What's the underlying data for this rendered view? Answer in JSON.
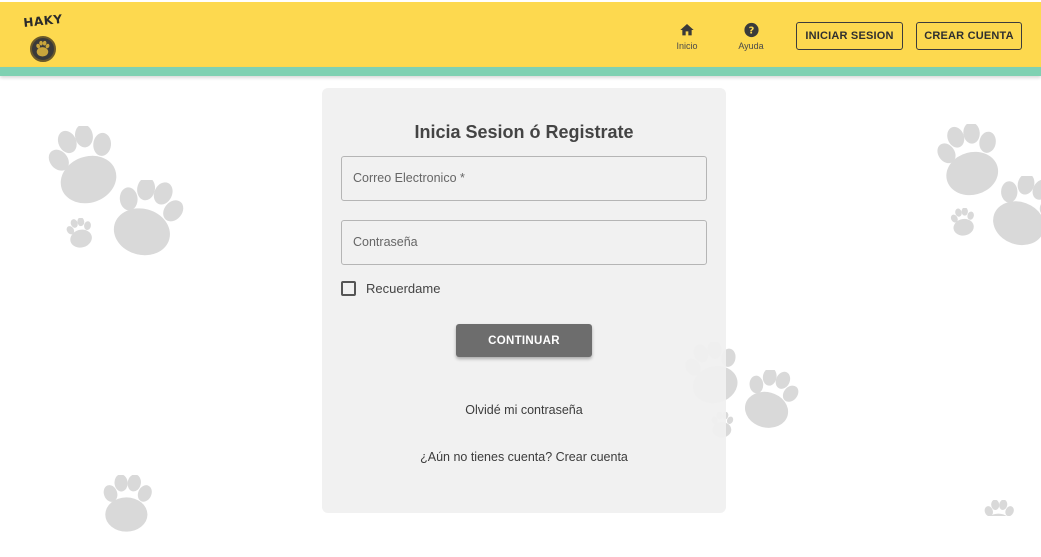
{
  "header": {
    "logo_text": "HAKY",
    "nav": [
      {
        "label": "Inicio",
        "icon": "home-icon"
      },
      {
        "label": "Ayuda",
        "icon": "help-icon"
      }
    ],
    "login_label": "INICIAR SESION",
    "signup_label": "CREAR CUENTA",
    "colors": {
      "bar": "#fdd94f",
      "stripe": "#7fd1b2"
    }
  },
  "form": {
    "title": "Inicia Sesion ó Registrate",
    "email_placeholder": "Correo Electronico *",
    "password_placeholder": "Contraseña",
    "remember_label": "Recuerdame",
    "remember_checked": false,
    "submit_label": "CONTINUAR",
    "forgot_label": "Olvidé mi contraseña",
    "register_prompt": "¿Aún no tienes cuenta? Crear cuenta"
  },
  "background": {
    "pattern": "paw-print-icon"
  }
}
